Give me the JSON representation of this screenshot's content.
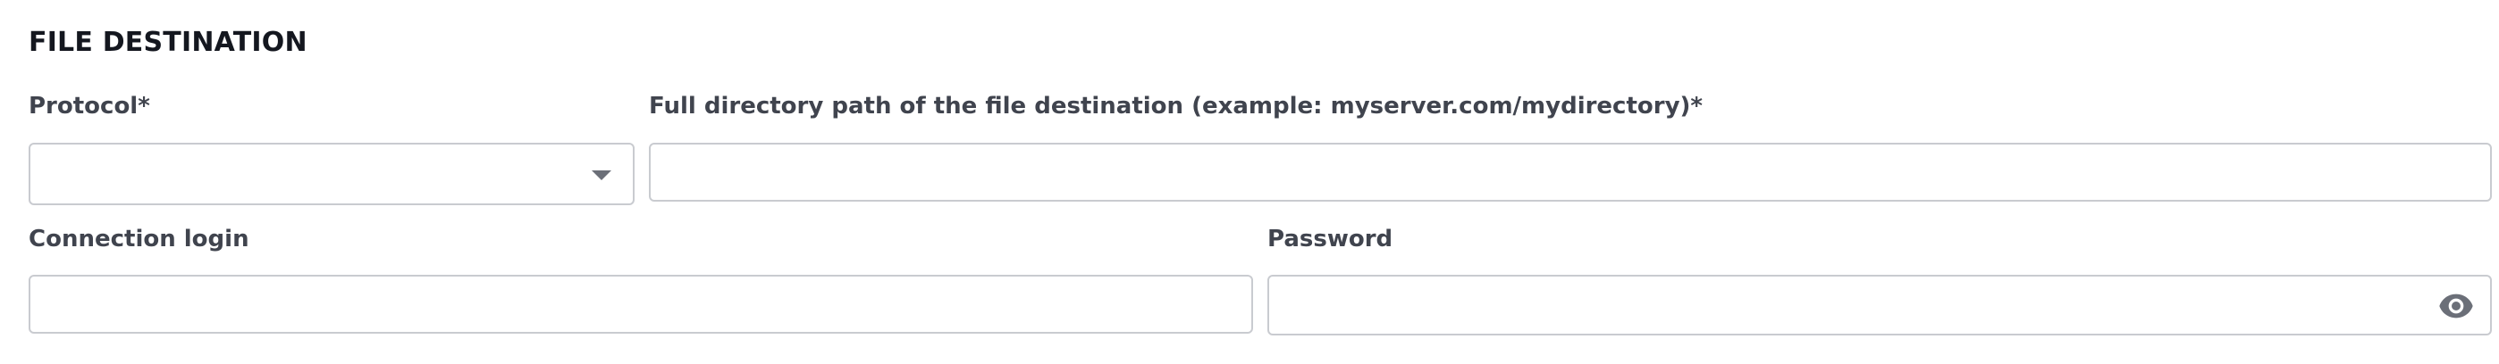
{
  "section": {
    "title": "FILE DESTINATION"
  },
  "protocol": {
    "label": "Protocol*",
    "value": "",
    "options": []
  },
  "directory": {
    "label": "Full directory path of the file destination (example: myserver.com/mydirectory)*",
    "value": "",
    "placeholder": ""
  },
  "login": {
    "label": "Connection login",
    "value": "",
    "placeholder": ""
  },
  "password": {
    "label": "Password",
    "value": "",
    "placeholder": "",
    "toggle_icon": "eye-icon"
  },
  "colors": {
    "border": "#c9cbd0",
    "label": "#40444e",
    "title": "#14171f",
    "icon": "#6b6f78"
  }
}
